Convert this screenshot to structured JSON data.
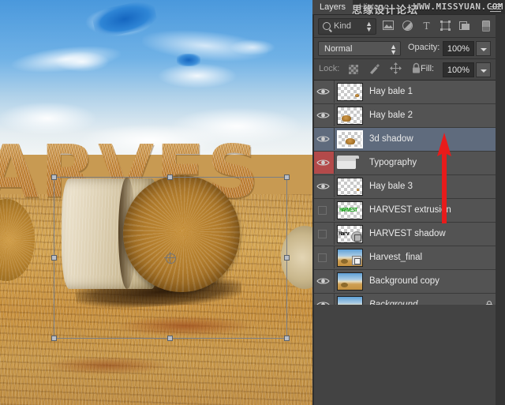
{
  "watermark": {
    "cn": "思缘设计论坛",
    "en": "WWW.MISSYUAN.COM"
  },
  "panel": {
    "tabs": [
      {
        "label": "Layers",
        "active": true
      },
      {
        "label": "History",
        "active": false
      }
    ],
    "menu_icon": "panel-menu-icon",
    "filter": {
      "search_icon": "search-icon",
      "kind_label": "Kind",
      "stepper_icon": "updown-stepper-icon",
      "type_filters": [
        {
          "name": "filter-pixel-icon",
          "title": "Pixel layers"
        },
        {
          "name": "filter-adjustment-icon",
          "title": "Adjustment layers"
        },
        {
          "name": "filter-type-icon",
          "title": "Type layers"
        },
        {
          "name": "filter-shape-icon",
          "title": "Shape layers"
        },
        {
          "name": "filter-smartobject-icon",
          "title": "Smart objects"
        },
        {
          "name": "filter-toggle-icon",
          "title": "Filter on/off"
        }
      ]
    },
    "blend": {
      "mode": "Normal",
      "opacity_label": "Opacity:",
      "opacity_value": "100%",
      "fill_label": "Fill:",
      "fill_value": "100%"
    },
    "lock": {
      "label": "Lock:",
      "icons": [
        {
          "name": "lock-transparent-pixels-icon"
        },
        {
          "name": "lock-image-pixels-icon"
        },
        {
          "name": "lock-position-icon"
        },
        {
          "name": "lock-all-icon"
        }
      ]
    },
    "layers": [
      {
        "name": "Hay bale 1",
        "visible": true,
        "selected": false,
        "thumb": "transparent-bale-small-right",
        "italic": false,
        "locked": false,
        "badge": "none",
        "group": false
      },
      {
        "name": "Hay bale 2",
        "visible": true,
        "selected": false,
        "thumb": "transparent-bale-left",
        "italic": false,
        "locked": false,
        "badge": "none",
        "group": false
      },
      {
        "name": "3d shadow",
        "visible": true,
        "selected": true,
        "thumb": "transparent-bale-center",
        "italic": false,
        "locked": false,
        "badge": "none",
        "group": false
      },
      {
        "name": "Typography",
        "visible": true,
        "selected": false,
        "thumb": "folder",
        "italic": false,
        "locked": false,
        "badge": "none",
        "group": true
      },
      {
        "name": "Hay bale 3",
        "visible": true,
        "selected": false,
        "thumb": "transparent-empty",
        "italic": false,
        "locked": false,
        "badge": "none",
        "group": false
      },
      {
        "name": "HARVEST extrusion",
        "visible": false,
        "selected": false,
        "thumb": "green-text",
        "italic": false,
        "locked": false,
        "badge": "none",
        "group": false
      },
      {
        "name": "HARVEST shadow",
        "visible": false,
        "selected": false,
        "thumb": "black-text",
        "italic": false,
        "locked": false,
        "badge": "cube",
        "group": false
      },
      {
        "name": "Harvest_final",
        "visible": false,
        "selected": false,
        "thumb": "photo",
        "italic": false,
        "locked": false,
        "badge": "smart",
        "group": false
      },
      {
        "name": "Background copy",
        "visible": true,
        "selected": false,
        "thumb": "photo",
        "italic": false,
        "locked": false,
        "badge": "none",
        "group": false
      },
      {
        "name": "Background",
        "visible": true,
        "selected": false,
        "thumb": "photo",
        "italic": true,
        "locked": true,
        "badge": "none",
        "group": false
      }
    ]
  },
  "canvas": {
    "headline_text": "ARVES",
    "transform_selection": "active",
    "handles": [
      "top-left",
      "top-center",
      "top-right",
      "middle-left",
      "middle-right",
      "bottom-left",
      "bottom-center",
      "bottom-right"
    ]
  },
  "annotation": {
    "arrow_name": "red-up-arrow-annotation",
    "arrow_color": "#e81b1b",
    "direction": "up"
  },
  "colors": {
    "panel_bg": "#3e3e3e",
    "row_bg": "#535353",
    "selected_row": "#5f6b7d",
    "visible_highlight": "#b34a4a",
    "accent_red": "#e81b1b"
  }
}
